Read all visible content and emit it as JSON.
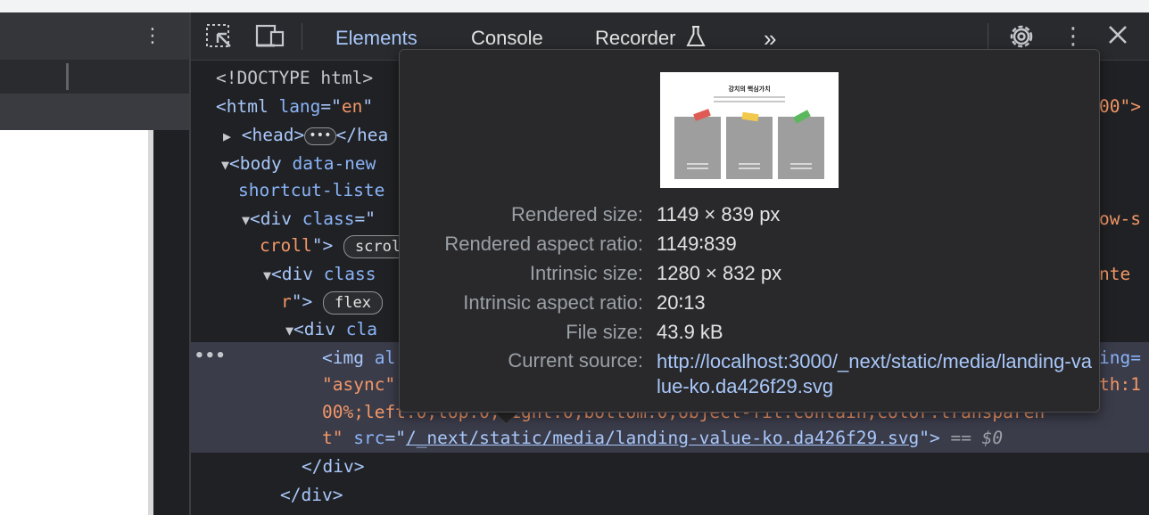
{
  "devtools": {
    "tabs": [
      {
        "label": "Elements",
        "active": true
      },
      {
        "label": "Console",
        "active": false
      },
      {
        "label": "Recorder",
        "active": false
      }
    ],
    "more_tabs_label": "»"
  },
  "tree": {
    "doctype": "<!DOCTYPE html>",
    "html_open": "<html",
    "html_attr": "lang",
    "html_eq": "=\"",
    "html_val": "en",
    "html_tail_right": "00\">",
    "head_open": "<head>",
    "head_close": "</hea",
    "body_open": "<body",
    "body_attr": "data-new",
    "body_attr2": "shortcut-liste",
    "div1_open": "<div",
    "div1_attr": "class",
    "div1_eq": "=\"",
    "div1_right": "ow-s",
    "div1_cont": "croll",
    "div1_close": "\">",
    "pill_scroll": "scrol",
    "div2_open": "<div",
    "div2_attr": "class",
    "div2_right": "nte",
    "div2_cont": "r",
    "div2_close": "\">",
    "pill_flex": "flex",
    "div3_open": "<div",
    "div3_attr": "cla",
    "img_open": "<img",
    "img_attr": "al",
    "img_right1": "ing=",
    "img_async": "\"async\"",
    "img_right2": "th:1",
    "img_style_line": "00%;left:0;top:0;right:0;bottom:0;object-fit:contain;color:transparen",
    "img_style_end": "t\"",
    "img_src_attr": "src",
    "img_src_eq": "=\"",
    "img_src_val": "/_next/static/media/landing-value-ko.da426f29.svg",
    "img_src_close": "\">",
    "eq_dollar": "== $0",
    "div_close1": "</div>",
    "div_close2": "</div>"
  },
  "tooltip": {
    "thumb_title": "강치의 핵심가치",
    "rows": [
      {
        "label": "Rendered size:",
        "value": "1149 × 839 px"
      },
      {
        "label": "Rendered aspect ratio:",
        "value": "1149∶839"
      },
      {
        "label": "Intrinsic size:",
        "value": "1280 × 832 px"
      },
      {
        "label": "Intrinsic aspect ratio:",
        "value": "20∶13"
      },
      {
        "label": "File size:",
        "value": "43.9 kB"
      }
    ],
    "source_label": "Current source:",
    "source_value": "http://localhost:3000/_next/static/media/landing-value-ko.da426f29.svg"
  },
  "colors": {
    "accent": "#a8c7fa",
    "attr_value": "#f29766",
    "tape_red": "#e05a55",
    "tape_yellow": "#f2c94c",
    "tape_green": "#5cb85c"
  }
}
